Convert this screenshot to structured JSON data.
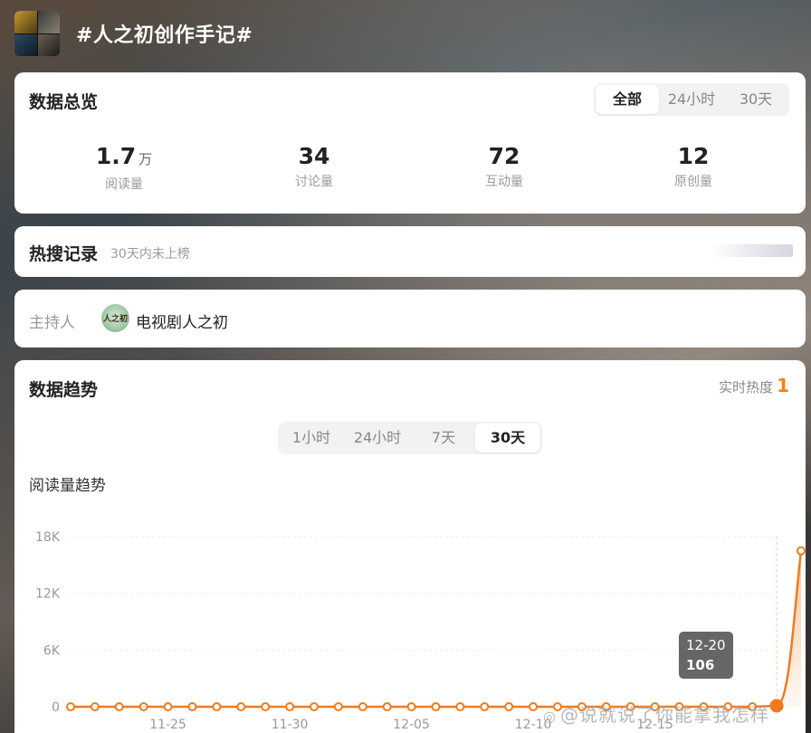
{
  "topic": {
    "title": "#人之初创作手记#"
  },
  "overview": {
    "title": "数据总览",
    "filters": [
      "全部",
      "24小时",
      "30天"
    ],
    "active_filter": "全部",
    "stats": [
      {
        "value": "1.7",
        "unit": "万",
        "label": "阅读量"
      },
      {
        "value": "34",
        "unit": "",
        "label": "讨论量"
      },
      {
        "value": "72",
        "unit": "",
        "label": "互动量"
      },
      {
        "value": "12",
        "unit": "",
        "label": "原创量"
      }
    ]
  },
  "hot_search": {
    "title": "热搜记录",
    "subtitle": "30天内未上榜"
  },
  "host": {
    "label": "主持人",
    "avatar_text": "人之初",
    "name": "电视剧人之初"
  },
  "trend": {
    "title": "数据趋势",
    "realtime_label": "实时热度",
    "realtime_value": "1",
    "ranges": [
      "1小时",
      "24小时",
      "7天",
      "30天"
    ],
    "active_range": "30天",
    "chart_title": "阅读量趋势"
  },
  "tooltip": {
    "date": "12-20",
    "value": "106"
  },
  "watermark": {
    "text": "@说就说了你能拿我怎样"
  },
  "colors": {
    "accent": "#ff8200",
    "line": "#f07b1e"
  },
  "chart_data": {
    "type": "line",
    "title": "阅读量趋势",
    "xlabel": "",
    "ylabel": "",
    "ylim": [
      0,
      18000
    ],
    "yticks": [
      "0",
      "6K",
      "12K",
      "18K"
    ],
    "ytick_values": [
      0,
      6000,
      12000,
      18000
    ],
    "xtick_labels": [
      "11-25",
      "11-30",
      "12-05",
      "12-10",
      "12-15"
    ],
    "x": [
      "11-21",
      "11-22",
      "11-23",
      "11-24",
      "11-25",
      "11-26",
      "11-27",
      "11-28",
      "11-29",
      "11-30",
      "12-01",
      "12-02",
      "12-03",
      "12-04",
      "12-05",
      "12-06",
      "12-07",
      "12-08",
      "12-09",
      "12-10",
      "12-11",
      "12-12",
      "12-13",
      "12-14",
      "12-15",
      "12-16",
      "12-17",
      "12-18",
      "12-19",
      "12-20",
      "12-21"
    ],
    "series": [
      {
        "values": [
          0,
          0,
          0,
          0,
          0,
          0,
          0,
          0,
          0,
          0,
          0,
          0,
          0,
          0,
          0,
          0,
          0,
          0,
          0,
          0,
          0,
          0,
          0,
          0,
          0,
          0,
          0,
          0,
          0,
          106,
          16500
        ]
      }
    ],
    "grid": true,
    "highlight_point": {
      "x": "12-20",
      "y": 106
    }
  }
}
